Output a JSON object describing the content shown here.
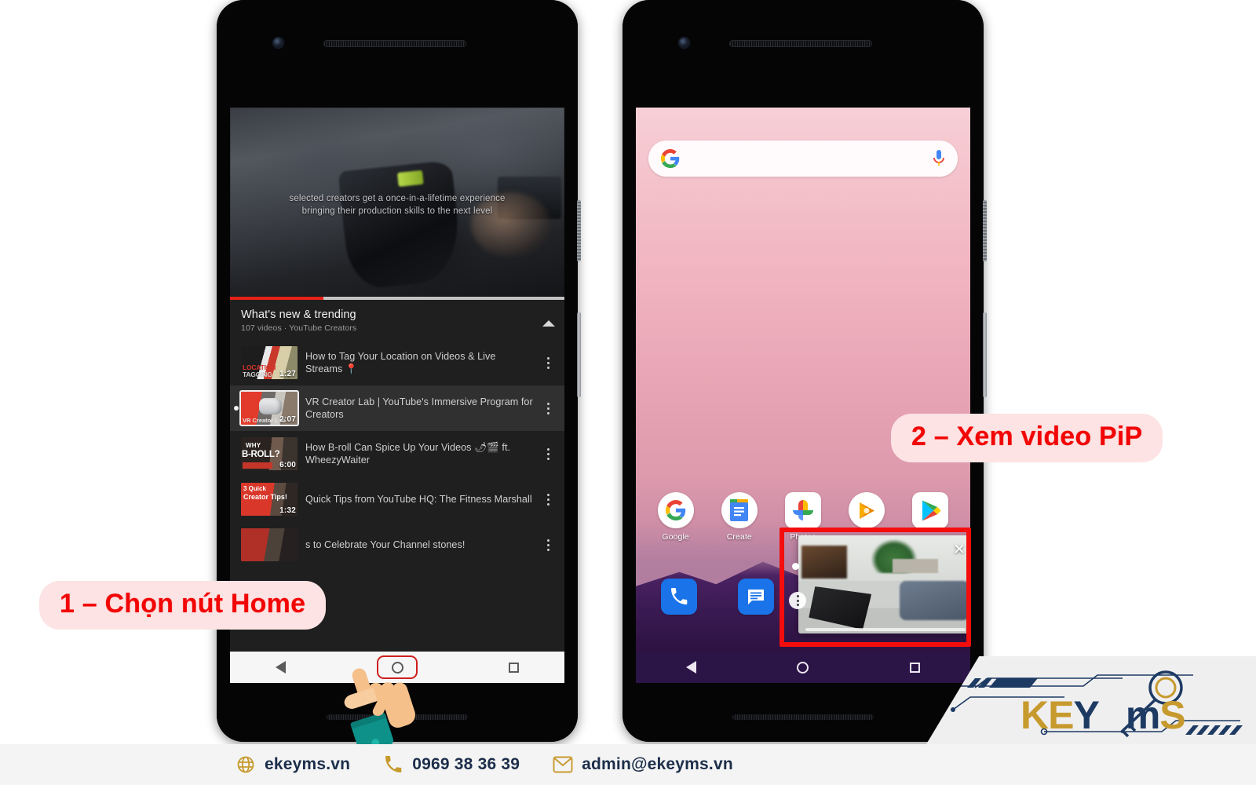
{
  "page": {
    "background": "#ffffff",
    "accent_red": "#f20505",
    "callout_bg": "#fde3e3"
  },
  "callouts": [
    {
      "id": "step-1",
      "text": "1 – Chọn nút Home"
    },
    {
      "id": "step-2",
      "text": "2 – Xem video PiP"
    }
  ],
  "left_phone": {
    "app": "YouTube",
    "player": {
      "caption_line1": "selected creators get a once-in-a-lifetime experience",
      "caption_line2": "bringing their production skills to the next level",
      "progress_percent": 28
    },
    "section": {
      "title": "What's new & trending",
      "subtitle": "107 videos · YouTube Creators",
      "collapse_icon": "chevron-up-icon"
    },
    "videos": [
      {
        "title": "How to Tag Your Location on Videos & Live Streams 📍",
        "duration": "1:27",
        "thumb_text_top": "LOCATION",
        "thumb_text_bottom": "TAGGING",
        "active": false
      },
      {
        "title": "VR Creator Lab | YouTube's Immersive Program for Creators",
        "duration": "2:07",
        "thumb_text_top": "VR Creator Lab",
        "thumb_text_bottom": "",
        "active": true
      },
      {
        "title": "How B-roll Can Spice Up Your Videos 🌶🎬 ft. WheezyWaiter",
        "duration": "6:00",
        "thumb_text_top": "WHY",
        "thumb_text_bottom": "B-ROLL?",
        "active": false
      },
      {
        "title": "Quick Tips from YouTube HQ: The Fitness Marshall",
        "duration": "1:32",
        "thumb_text_top": "3 Quick",
        "thumb_text_bottom": "Creator Tips!",
        "active": false
      },
      {
        "title": "s to Celebrate Your Channel stones!",
        "duration": "",
        "thumb_text_top": "",
        "thumb_text_bottom": "",
        "active": false
      }
    ],
    "navbar": {
      "back": "back-triangle-icon",
      "home": "home-circle-icon",
      "recents": "recents-square-icon",
      "highlighted": "home"
    }
  },
  "right_phone": {
    "search": {
      "logo": "google-g-icon",
      "mic": "microphone-icon",
      "value": "",
      "placeholder": ""
    },
    "apps_row1": [
      {
        "label": "Google",
        "icon": "google-g-icon"
      },
      {
        "label": "Create",
        "icon": "google-docs-icon"
      },
      {
        "label": "Photos",
        "icon": "google-photos-icon"
      },
      {
        "label": "",
        "icon": "play-movies-icon"
      },
      {
        "label": "",
        "icon": "play-store-icon"
      }
    ],
    "apps_dock": [
      {
        "label": "",
        "icon": "phone-icon"
      },
      {
        "label": "",
        "icon": "messages-icon"
      }
    ],
    "pip": {
      "close_icon": "close-x-icon",
      "menu_icon": "more-vertical-icon",
      "highlight_color": "#f40d0d"
    },
    "navbar": {
      "back": "back-triangle-icon",
      "home": "home-circle-icon",
      "recents": "recents-square-icon"
    }
  },
  "footer": {
    "items": [
      {
        "icon": "globe-icon",
        "text": "ekeyms.vn"
      },
      {
        "icon": "phone-icon",
        "text": "0969 38 36 39"
      },
      {
        "icon": "envelope-icon",
        "text": "admin@ekeyms.vn"
      }
    ],
    "text_color": "#1c2e4a",
    "icon_color": "#c79a2e"
  },
  "logo": {
    "part1": "KE",
    "part2": "Y",
    "part3": "m",
    "part4": "S",
    "gold": "#c79a2e",
    "navy": "#1d3a63"
  }
}
